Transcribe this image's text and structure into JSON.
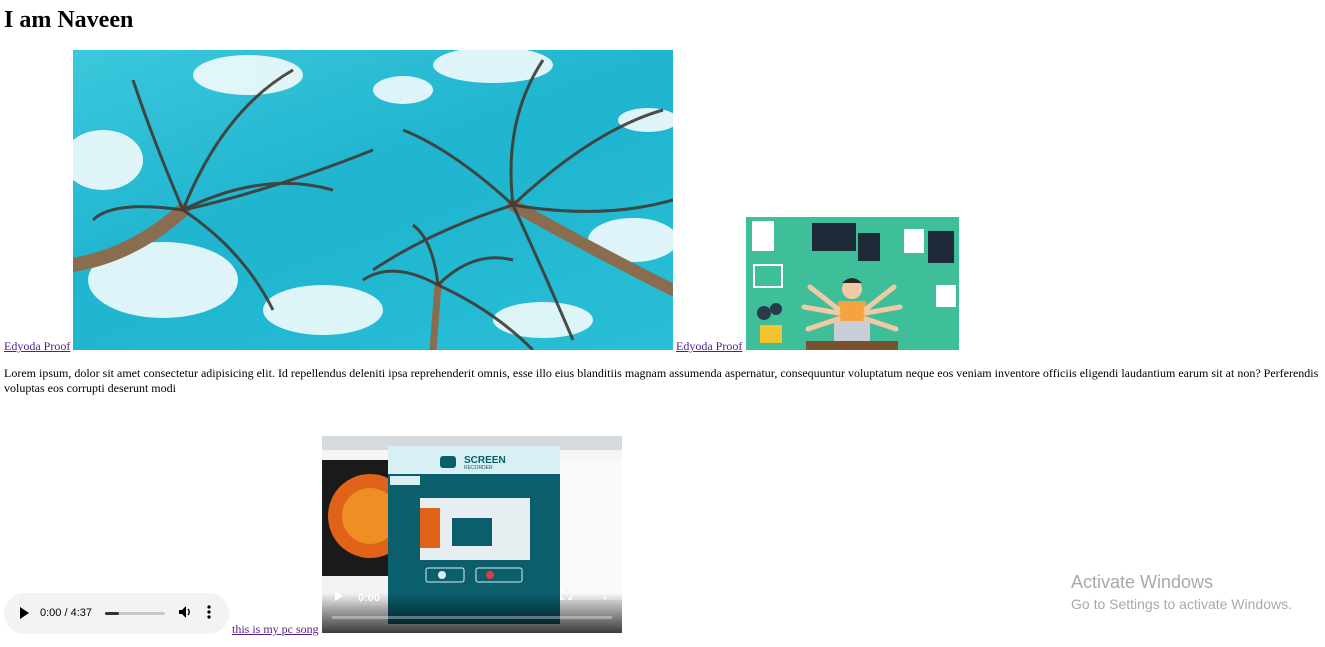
{
  "page": {
    "heading": "I am Naveen"
  },
  "links": {
    "first": "Edyoda Proof",
    "second": "Edyoda Proof",
    "song": "this is my pc song"
  },
  "paragraph": "Lorem ipsum, dolor sit amet consectetur adipisicing elit. Id repellendus deleniti ipsa reprehenderit omnis, esse illo eius blanditiis magnam assumenda aspernatur, consequuntur voluptatum neque eos veniam inventore officiis eligendi laudantium earum sit at non? Perferendis voluptas eos corrupti deserunt modi",
  "images": {
    "palm": {
      "icon": "palm-trees-photo"
    },
    "dev": {
      "icon": "multitasking-developer-illustration"
    }
  },
  "audio": {
    "time": "0:00 / 4:37",
    "progress": 0.23
  },
  "video": {
    "time": "0:00",
    "screen_title": "SCREEN",
    "screen_subtitle": "RECORDER"
  },
  "watermark": {
    "line1": "Activate Windows",
    "line2": "Go to Settings to activate Windows."
  },
  "colors": {
    "link": "#551a8b",
    "video_bg": "#0b5e6b",
    "sky": "#1fb4cf",
    "illustration_bg": "#3ebf9a"
  }
}
